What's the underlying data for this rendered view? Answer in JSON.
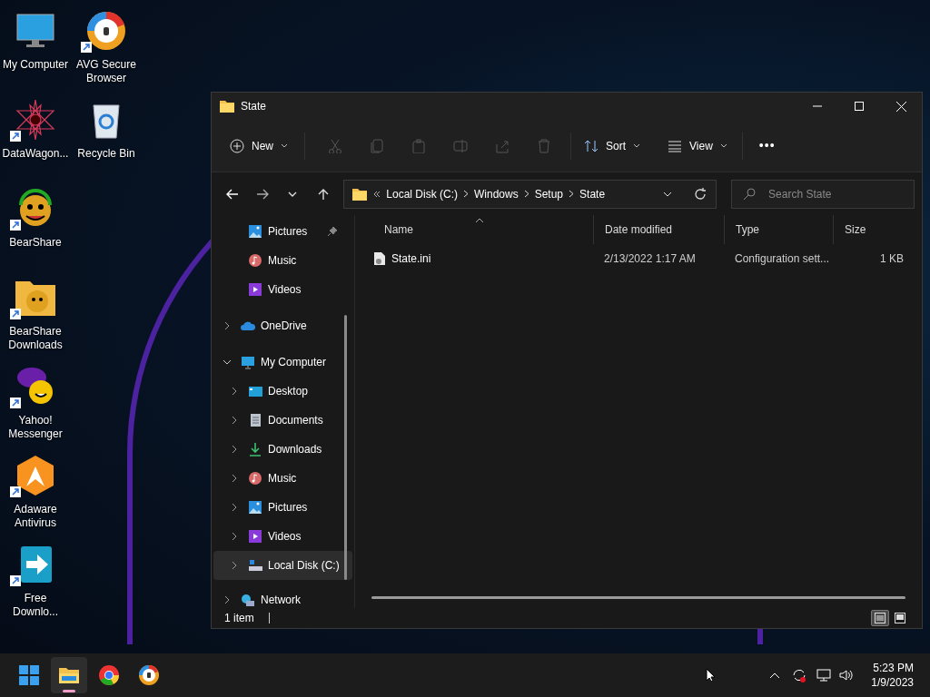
{
  "desktop_icons": [
    {
      "label": "My Computer",
      "kind": "monitor",
      "shortcut": false
    },
    {
      "label": "DataWagon...",
      "kind": "star",
      "shortcut": true
    },
    {
      "label": "BearShare",
      "kind": "bear",
      "shortcut": true
    },
    {
      "label": "BearShare Downloads",
      "kind": "bearfolder",
      "shortcut": true
    },
    {
      "label": "Yahoo! Messenger",
      "kind": "yahoo",
      "shortcut": true
    },
    {
      "label": "Adaware Antivirus",
      "kind": "adaware",
      "shortcut": true
    },
    {
      "label": "Free Downlo...",
      "kind": "download",
      "shortcut": true
    },
    {
      "label": "AVG Secure Browser",
      "kind": "avg",
      "shortcut": true
    },
    {
      "label": "Recycle Bin",
      "kind": "bin",
      "shortcut": false
    }
  ],
  "window": {
    "title": "State",
    "toolbar": {
      "new": "New",
      "sort": "Sort",
      "view": "View",
      "more": "•••"
    },
    "address": {
      "segments": [
        "Local Disk (C:)",
        "Windows",
        "Setup",
        "State"
      ],
      "search_placeholder": "Search State"
    },
    "nav": [
      {
        "label": "Pictures",
        "kind": "pictures",
        "chevron": false,
        "pinned": true,
        "selected": false
      },
      {
        "label": "Music",
        "kind": "music",
        "chevron": false,
        "pinned": false,
        "selected": false
      },
      {
        "label": "Videos",
        "kind": "videos",
        "chevron": false,
        "pinned": false,
        "selected": false
      },
      {
        "label": "OneDrive",
        "kind": "cloud",
        "chevron": true,
        "expanded": false,
        "pinned": false,
        "selected": false
      },
      {
        "label": "My Computer",
        "kind": "monitor",
        "chevron": true,
        "expanded": true,
        "pinned": false,
        "selected": false,
        "children": [
          {
            "label": "Desktop",
            "kind": "desktop",
            "chevron": true,
            "expanded": false,
            "pinned": false,
            "selected": false
          },
          {
            "label": "Documents",
            "kind": "documents",
            "chevron": true,
            "expanded": false,
            "pinned": false,
            "selected": false
          },
          {
            "label": "Downloads",
            "kind": "downloads",
            "chevron": true,
            "expanded": false,
            "pinned": false,
            "selected": false
          },
          {
            "label": "Music",
            "kind": "music",
            "chevron": true,
            "expanded": false,
            "pinned": false,
            "selected": false
          },
          {
            "label": "Pictures",
            "kind": "pictures",
            "chevron": true,
            "expanded": false,
            "pinned": false,
            "selected": false
          },
          {
            "label": "Videos",
            "kind": "videos",
            "chevron": true,
            "expanded": false,
            "pinned": false,
            "selected": false
          },
          {
            "label": "Local Disk (C:)",
            "kind": "disk",
            "chevron": true,
            "expanded": false,
            "pinned": false,
            "selected": true
          }
        ]
      },
      {
        "label": "Network",
        "kind": "network",
        "chevron": true,
        "expanded": false,
        "pinned": false,
        "selected": false
      }
    ],
    "columns": [
      {
        "label": "Name",
        "sorted": true
      },
      {
        "label": "Date modified",
        "sorted": false
      },
      {
        "label": "Type",
        "sorted": false
      },
      {
        "label": "Size",
        "sorted": false
      }
    ],
    "rows": [
      {
        "name": "State.ini",
        "date": "2/13/2022 1:17 AM",
        "type": "Configuration sett...",
        "size": "1 KB"
      }
    ],
    "status": "1 item",
    "view_modes": [
      {
        "kind": "details",
        "selected": true
      },
      {
        "kind": "tiles",
        "selected": false
      }
    ]
  },
  "taskbar": {
    "apps": [
      {
        "kind": "start",
        "selected": false
      },
      {
        "kind": "explorer",
        "selected": true
      },
      {
        "kind": "chrome",
        "selected": false
      },
      {
        "kind": "avg",
        "selected": false
      }
    ],
    "time": "5:23 PM",
    "date": "1/9/2023"
  }
}
